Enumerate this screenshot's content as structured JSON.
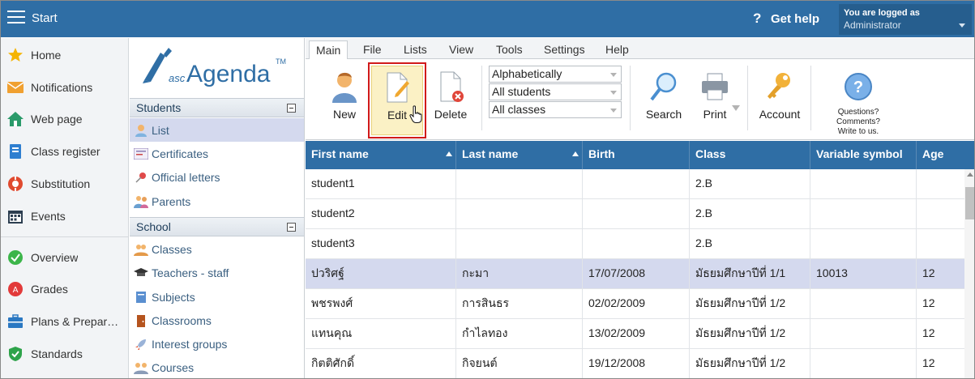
{
  "topbar": {
    "title": "Start",
    "help_label": "Get help",
    "logged_label": "You are logged as",
    "user": "Administrator"
  },
  "nav": [
    {
      "label": "Home",
      "icon": "star-icon"
    },
    {
      "label": "Notifications",
      "icon": "envelope-icon"
    },
    {
      "label": "Web page",
      "icon": "house-icon"
    },
    {
      "label": "Class register",
      "icon": "book-icon"
    },
    {
      "label": "Substitution",
      "icon": "lifebuoy-icon"
    },
    {
      "label": "Events",
      "icon": "calendar-icon"
    },
    {
      "label": "Overview",
      "icon": "check-circle-icon"
    },
    {
      "label": "Grades",
      "icon": "grade-icon"
    },
    {
      "label": "Plans & Preparations",
      "icon": "briefcase-icon"
    },
    {
      "label": "Standards",
      "icon": "shield-check-icon"
    }
  ],
  "logo": {
    "prefix": "asc",
    "name": "Agenda",
    "tm": "TM"
  },
  "students_section": {
    "title": "Students",
    "items": [
      "List",
      "Certificates",
      "Official letters",
      "Parents"
    ]
  },
  "school_section": {
    "title": "School",
    "items": [
      "Classes",
      "Teachers - staff",
      "Subjects",
      "Classrooms",
      "Interest groups",
      "Courses"
    ]
  },
  "tabs": [
    "Main",
    "File",
    "Lists",
    "View",
    "Tools",
    "Settings",
    "Help"
  ],
  "ribbon": {
    "new_label": "New",
    "edit_label": "Edit",
    "delete_label": "Delete",
    "sort_select": "Alphabetically",
    "students_select": "All students",
    "classes_select": "All classes",
    "search_label": "Search",
    "print_label": "Print",
    "account_label": "Account",
    "questions_label": "Questions? Comments? Write to us."
  },
  "table": {
    "columns": [
      "First name",
      "Last name",
      "Birth",
      "Class",
      "Variable symbol",
      "Age"
    ],
    "rows": [
      [
        "student1",
        "",
        "",
        "2.B",
        "",
        ""
      ],
      [
        "student2",
        "",
        "",
        "2.B",
        "",
        ""
      ],
      [
        "student3",
        "",
        "",
        "2.B",
        "",
        ""
      ],
      [
        "ปวริศฐ์",
        "กะมา",
        "17/07/2008",
        "มัธยมศึกษาปีที่ 1/1",
        "10013",
        "12"
      ],
      [
        "พชรพงศ์",
        "การสินธร",
        "02/02/2009",
        "มัธยมศึกษาปีที่ 1/2",
        "",
        "12"
      ],
      [
        "แทนคุณ",
        "กำไลทอง",
        "13/02/2009",
        "มัธยมศึกษาปีที่ 1/2",
        "",
        "12"
      ],
      [
        "กิตติศักดิ์",
        "กิจยนต์",
        "19/12/2008",
        "มัธยมศึกษาปีที่ 1/2",
        "",
        "12"
      ]
    ],
    "selected_row": 3
  },
  "colors": {
    "topbar": "#2f6ea5",
    "selection": "#d4d9ee",
    "edit_highlight": "#fbf1c5",
    "edit_outline": "#d11a1a"
  }
}
